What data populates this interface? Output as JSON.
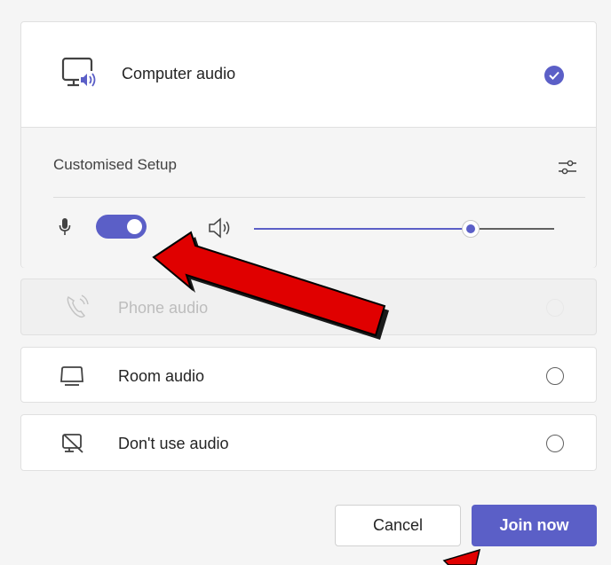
{
  "computer_audio": {
    "label": "Computer audio",
    "selected": true,
    "setup_title": "Customised Setup",
    "mic_on": true,
    "speaker_volume": 0.72
  },
  "options": [
    {
      "label": "Phone audio",
      "icon": "phone-icon",
      "disabled": true
    },
    {
      "label": "Room audio",
      "icon": "room-icon",
      "disabled": false
    },
    {
      "label": "Don't use audio",
      "icon": "no-audio-icon",
      "disabled": false
    }
  ],
  "buttons": {
    "cancel": "Cancel",
    "join": "Join now"
  },
  "colors": {
    "accent": "#5b5fc7",
    "annotation_arrow": "#e00000"
  }
}
